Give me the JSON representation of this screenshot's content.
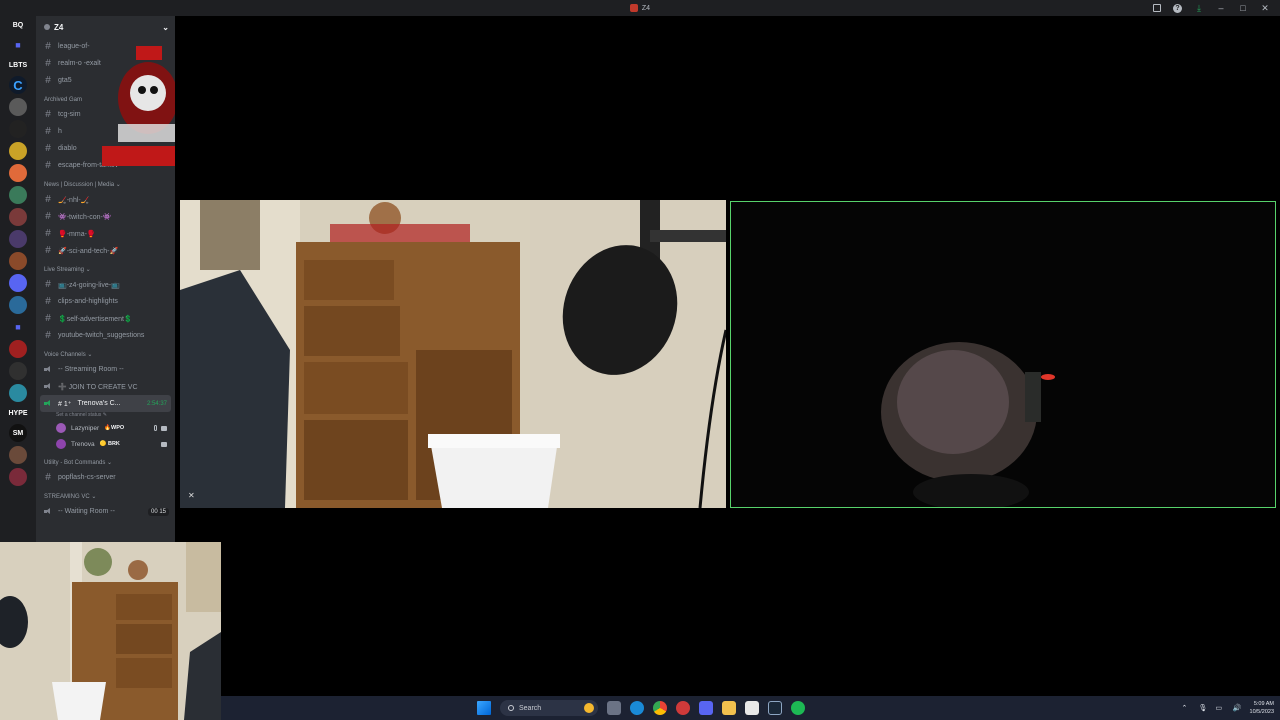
{
  "window": {
    "title": "Z4",
    "controls": {
      "minimize": "–",
      "maximize": "□",
      "close": "✕"
    }
  },
  "servers": [
    {
      "label": "BQ",
      "kind": "text"
    },
    {
      "label": "■",
      "kind": "folder"
    },
    {
      "label": "LBTS",
      "kind": "text"
    },
    {
      "label": "C",
      "kind": "c"
    },
    {
      "label": "",
      "kind": "avatar",
      "color": "#5a5a5a"
    },
    {
      "label": "",
      "kind": "avatar",
      "color": "#222222"
    },
    {
      "label": "",
      "kind": "avatar",
      "color": "#c9a227"
    },
    {
      "label": "",
      "kind": "avatar",
      "color": "#e06a3a"
    },
    {
      "label": "",
      "kind": "avatar",
      "color": "#3a7a5a"
    },
    {
      "label": "",
      "kind": "avatar",
      "color": "#7a3a3a"
    },
    {
      "label": "",
      "kind": "avatar",
      "color": "#4a3a6a"
    },
    {
      "label": "",
      "kind": "avatar",
      "color": "#8a4a2a"
    },
    {
      "label": "",
      "kind": "avatar",
      "color": "#5865f2"
    },
    {
      "label": "",
      "kind": "avatar",
      "color": "#2a6a9a"
    },
    {
      "label": "■",
      "kind": "folder"
    },
    {
      "label": "",
      "kind": "avatar",
      "color": "#a02020"
    },
    {
      "label": "",
      "kind": "avatar",
      "color": "#303030"
    },
    {
      "label": "",
      "kind": "avatar",
      "color": "#2a8aa0"
    },
    {
      "label": "HYPE",
      "kind": "text"
    },
    {
      "label": "SM",
      "kind": "avatar",
      "color": "#111111"
    },
    {
      "label": "",
      "kind": "avatar",
      "color": "#6a4a3a"
    },
    {
      "label": "",
      "kind": "avatar",
      "color": "#7a2a3a"
    }
  ],
  "sidebar": {
    "server_name": "Z4",
    "items": [
      {
        "type": "channel",
        "name": "league-of-"
      },
      {
        "type": "channel",
        "name": "realm-o          -exalt"
      },
      {
        "type": "channel",
        "name": "gta5"
      },
      {
        "type": "category",
        "name": "Archived Gam"
      },
      {
        "type": "channel",
        "name": "tcg-sim"
      },
      {
        "type": "channel",
        "name": "h"
      },
      {
        "type": "channel",
        "name": "diablo"
      },
      {
        "type": "channel",
        "name": "escape-from-tarkov"
      },
      {
        "type": "category",
        "name": "News | Discussion | Media  ⌄"
      },
      {
        "type": "channel",
        "name": "🏒-nhl-🏒"
      },
      {
        "type": "channel",
        "name": "👾-twitch-con-👾"
      },
      {
        "type": "channel",
        "name": "🥊-mma-🥊"
      },
      {
        "type": "channel",
        "name": "🚀-sci-and-tech-🚀"
      },
      {
        "type": "category",
        "name": "Live Streaming  ⌄"
      },
      {
        "type": "channel",
        "name": "📺-z4-going-live-📺"
      },
      {
        "type": "channel",
        "name": "clips-and-highlights"
      },
      {
        "type": "channel",
        "name": "💲self-advertisement💲"
      },
      {
        "type": "channel",
        "name": "youtube-twitch_suggestions"
      },
      {
        "type": "category",
        "name": "Voice Channels  ⌄"
      },
      {
        "type": "voice",
        "name": "-- Streaming Room --"
      },
      {
        "type": "voice",
        "name": "➕ JOIN TO CREATE VC"
      }
    ],
    "active_voice": {
      "prefix": "# 1⁺",
      "name": "Trenova's C...",
      "duration": "2:54:37",
      "status": "Set a channel status ✎"
    },
    "voice_users": [
      {
        "name": "Lazyniper",
        "badge": "🔥WPO",
        "color": "#9b59b6"
      },
      {
        "name": "Trenova",
        "badge": "🟡 BRK",
        "color": "#8e44ad"
      }
    ],
    "tail": [
      {
        "type": "category",
        "name": "Utility - Bot Commands  ⌄"
      },
      {
        "type": "channel",
        "name": "popflash-cs-server"
      },
      {
        "type": "category",
        "name": "STREAMING VC  ⌄"
      },
      {
        "type": "voice",
        "name": "-- Waiting Room --",
        "count": "00  15"
      }
    ]
  },
  "taskbar": {
    "search_placeholder": "Search",
    "time": "5:09 AM",
    "date": "10/5/2023"
  }
}
